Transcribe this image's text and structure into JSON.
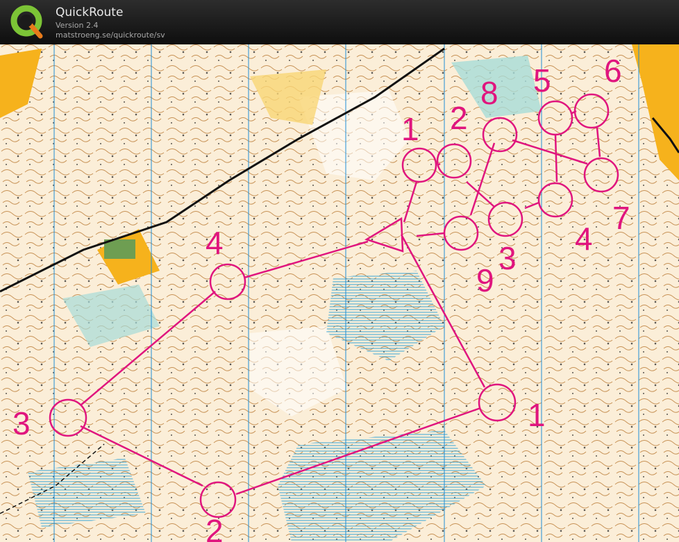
{
  "app": {
    "title": "QuickRoute",
    "version": "Version 2.4",
    "url": "matstroeng.se/quickroute/sv"
  },
  "map": {
    "course_color": "#e0157e",
    "course_a_numbers": [
      "1",
      "2",
      "3",
      "4"
    ],
    "course_b_numbers": [
      "1",
      "2",
      "8",
      "5",
      "6",
      "7",
      "4",
      "3",
      "9"
    ]
  }
}
